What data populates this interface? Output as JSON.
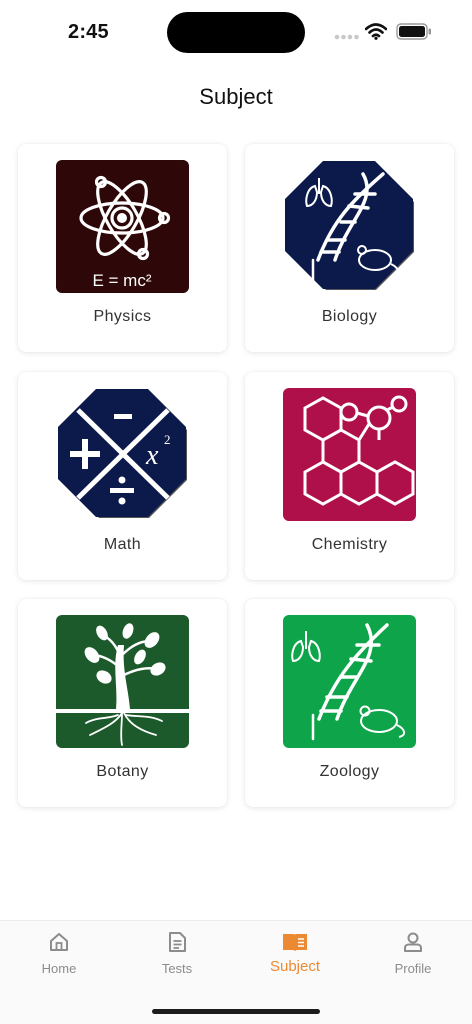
{
  "status_bar": {
    "time": "2:45"
  },
  "header": {
    "title": "Subject"
  },
  "subjects": [
    {
      "label": "Physics",
      "icon": "atom-icon",
      "color": "#2e0808",
      "formula": "E = mc²"
    },
    {
      "label": "Biology",
      "icon": "dna-icon",
      "color": "#0c1a4b"
    },
    {
      "label": "Math",
      "icon": "math-operators-icon",
      "color": "#0c1a4b"
    },
    {
      "label": "Chemistry",
      "icon": "molecule-icon",
      "color": "#b0104a"
    },
    {
      "label": "Botany",
      "icon": "plant-icon",
      "color": "#1d5a2b"
    },
    {
      "label": "Zoology",
      "icon": "dna-icon",
      "color": "#0ea54a"
    }
  ],
  "tab_bar": {
    "items": [
      {
        "label": "Home",
        "icon": "home-icon"
      },
      {
        "label": "Tests",
        "icon": "document-icon"
      },
      {
        "label": "Subject",
        "icon": "book-icon",
        "active": true
      },
      {
        "label": "Profile",
        "icon": "person-icon"
      }
    ],
    "active_color": "#ec8a33",
    "inactive_color": "#8c8c8c"
  }
}
